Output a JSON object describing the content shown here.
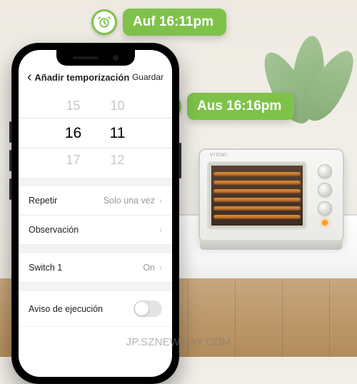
{
  "callouts": {
    "on": {
      "icon": "alarm-icon",
      "text": "Auf 16:11pm"
    },
    "off": {
      "icon": "alarm-icon",
      "text": "Aus 16:16pm"
    }
  },
  "oven": {
    "brand": "VIOMI"
  },
  "phone": {
    "nav": {
      "back_glyph": "‹",
      "title": "Añadir temporización",
      "save": "Guardar"
    },
    "picker": {
      "prev": {
        "h": "15",
        "m": "10"
      },
      "sel": {
        "h": "16",
        "m": "11"
      },
      "next": {
        "h": "17",
        "m": "12"
      }
    },
    "rows": {
      "repeat": {
        "label": "Repetir",
        "value": "Solo una vez",
        "chevron": "›"
      },
      "note": {
        "label": "Observación",
        "value": "",
        "chevron": "›"
      },
      "switch1": {
        "label": "Switch 1",
        "value": "On",
        "chevron": "›"
      },
      "notify": {
        "label": "Aviso de ejecución"
      }
    }
  },
  "watermark": "JP.SZNEWWAY.COM",
  "colors": {
    "accent": "#7fc24a"
  }
}
